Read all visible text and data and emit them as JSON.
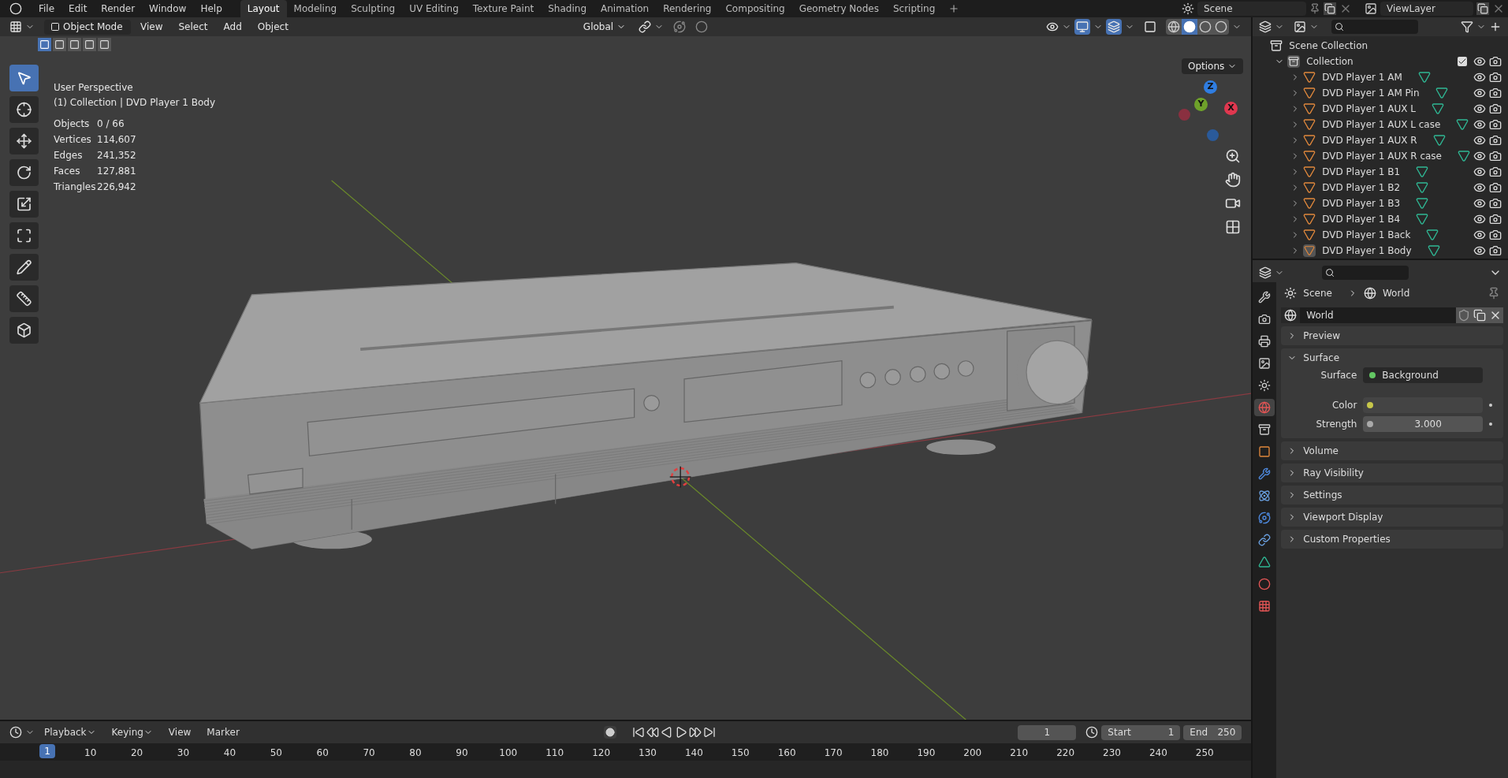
{
  "menu": [
    "File",
    "Edit",
    "Render",
    "Window",
    "Help"
  ],
  "workspaces": [
    {
      "label": "Layout",
      "selected": true
    },
    {
      "label": "Modeling",
      "selected": false
    },
    {
      "label": "Sculpting",
      "selected": false
    },
    {
      "label": "UV Editing",
      "selected": false
    },
    {
      "label": "Texture Paint",
      "selected": false
    },
    {
      "label": "Shading",
      "selected": false
    },
    {
      "label": "Animation",
      "selected": false
    },
    {
      "label": "Rendering",
      "selected": false
    },
    {
      "label": "Compositing",
      "selected": false
    },
    {
      "label": "Geometry Nodes",
      "selected": false
    },
    {
      "label": "Scripting",
      "selected": false
    }
  ],
  "scene": "Scene",
  "view_layer": "ViewLayer",
  "viewport": {
    "mode": "Object Mode",
    "menus": [
      "View",
      "Select",
      "Add",
      "Object"
    ],
    "orientation": "Global",
    "options": "Options",
    "select_modes": [
      {
        "selected": true
      },
      {
        "selected": false
      },
      {
        "selected": false
      },
      {
        "selected": false
      },
      {
        "selected": false
      }
    ],
    "shading_modes": [
      {
        "kind": "wireframe",
        "selected": false
      },
      {
        "kind": "solid",
        "selected": true
      },
      {
        "kind": "material",
        "selected": false
      },
      {
        "kind": "rendered",
        "selected": false
      }
    ],
    "title": "User Perspective",
    "subtitle": "(1) Collection | DVD Player 1 Body",
    "stats": [
      {
        "label": "Objects",
        "value": "0 / 66"
      },
      {
        "label": "Vertices",
        "value": "114,607"
      },
      {
        "label": "Edges",
        "value": "241,352"
      },
      {
        "label": "Faces",
        "value": "127,881"
      },
      {
        "label": "Triangles",
        "value": "226,942"
      }
    ],
    "tools": [
      {
        "kind": "select",
        "selected": true
      },
      {
        "kind": "cursor",
        "selected": false
      },
      {
        "kind": "move",
        "selected": false
      },
      {
        "kind": "rotate",
        "selected": false
      },
      {
        "kind": "scale",
        "selected": false
      },
      {
        "kind": "transform",
        "selected": false
      },
      {
        "kind": "annotate",
        "selected": false
      },
      {
        "kind": "measure",
        "selected": false
      },
      {
        "kind": "add_cube",
        "selected": false
      }
    ],
    "gizmo_axes": [
      {
        "label": "Z",
        "color": "#2f7de1"
      },
      {
        "label": "Y",
        "color": "#6ea12a"
      },
      {
        "label": "X",
        "color": "#e0374f"
      }
    ]
  },
  "outliner": {
    "root": "Scene Collection",
    "collection": {
      "name": "Collection",
      "expanded": true,
      "checked": true
    },
    "items": [
      {
        "name": "DVD Player 1 AM",
        "selected": false
      },
      {
        "name": "DVD Player 1 AM Pin",
        "selected": false
      },
      {
        "name": "DVD Player 1 AUX L",
        "selected": false
      },
      {
        "name": "DVD Player 1 AUX L case",
        "selected": false
      },
      {
        "name": "DVD Player 1 AUX R",
        "selected": false
      },
      {
        "name": "DVD Player 1 AUX R case",
        "selected": false
      },
      {
        "name": "DVD Player 1 B1",
        "selected": false
      },
      {
        "name": "DVD Player 1 B2",
        "selected": false
      },
      {
        "name": "DVD Player 1 B3",
        "selected": false
      },
      {
        "name": "DVD Player 1 B4",
        "selected": false
      },
      {
        "name": "DVD Player 1 Back",
        "selected": false
      },
      {
        "name": "DVD Player 1 Body",
        "selected": true
      }
    ]
  },
  "properties": {
    "tabs": [
      {
        "kind": "tool",
        "selected": false
      },
      {
        "kind": "render",
        "selected": false
      },
      {
        "kind": "output",
        "selected": false
      },
      {
        "kind": "view_layer",
        "selected": false
      },
      {
        "kind": "scene",
        "selected": false
      },
      {
        "kind": "world",
        "selected": true
      },
      {
        "kind": "collection",
        "selected": false
      },
      {
        "kind": "object",
        "selected": false
      },
      {
        "kind": "modifiers",
        "selected": false
      },
      {
        "kind": "particles",
        "selected": false
      },
      {
        "kind": "physics",
        "selected": false
      },
      {
        "kind": "constraints",
        "selected": false
      },
      {
        "kind": "data",
        "selected": false
      },
      {
        "kind": "material",
        "selected": false
      },
      {
        "kind": "texture",
        "selected": false
      }
    ],
    "breadcrumb": [
      "Scene",
      "World"
    ],
    "world_name": "World",
    "panels": [
      {
        "title": "Preview",
        "expanded": false
      },
      {
        "title": "Surface",
        "expanded": true
      },
      {
        "title": "Volume",
        "expanded": false
      },
      {
        "title": "Ray Visibility",
        "expanded": false
      },
      {
        "title": "Settings",
        "expanded": false
      },
      {
        "title": "Viewport Display",
        "expanded": false
      },
      {
        "title": "Custom Properties",
        "expanded": false
      }
    ],
    "surface": {
      "surface_label": "Surface",
      "surface_value": "Background",
      "color_label": "Color",
      "strength_label": "Strength",
      "strength_value": "3.000"
    }
  },
  "timeline": {
    "menus": [
      "Playback",
      "Keying",
      "View",
      "Marker"
    ],
    "current_frame": "1",
    "start_label": "Start",
    "start_value": "1",
    "end_label": "End",
    "end_value": "250",
    "playhead": "1",
    "ticks": [
      "10",
      "20",
      "30",
      "40",
      "50",
      "60",
      "70",
      "80",
      "90",
      "100",
      "110",
      "120",
      "130",
      "140",
      "150",
      "160",
      "170",
      "180",
      "190",
      "200",
      "210",
      "220",
      "230",
      "240",
      "250"
    ]
  }
}
